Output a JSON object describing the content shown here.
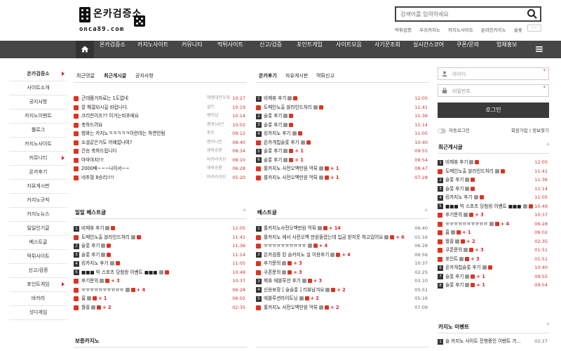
{
  "logo": {
    "title": "온카검증소",
    "site": "onca89.com"
  },
  "search": {
    "placeholder": "검색어를 입력하세요"
  },
  "keywords": [
    "먹튀검증",
    "우리카지노",
    "카지노사이트",
    "온라인카지노",
    "슬롯"
  ],
  "keyword_arrows": "‹ ›",
  "nav": [
    "온카검증소",
    "카지노사이트",
    "커뮤니티",
    "먹튀사이트",
    "신고/검증",
    "포인트게임",
    "사이트모음",
    "사기꾼조회",
    "실시간스코어",
    "쿠폰/문의",
    "업체홍보"
  ],
  "left_menu": [
    {
      "label": "온카검증소",
      "arrow": true
    },
    {
      "label": "사이트소개"
    },
    {
      "label": "공지사항"
    },
    {
      "label": "카지노이벤트"
    },
    {
      "label": "쁠로그"
    },
    {
      "label": "카지노사이트"
    },
    {
      "label": "커뮤니티",
      "arrow": true
    },
    {
      "label": "온카후기"
    },
    {
      "label": "자유게시판"
    },
    {
      "label": "카지노규칙"
    },
    {
      "label": "카지노뉴스"
    },
    {
      "label": "일일인기글"
    },
    {
      "label": "베스트글"
    },
    {
      "label": "먹튀사이트"
    },
    {
      "label": "신고/검증"
    },
    {
      "label": "포인트게임",
      "arrow": true
    },
    {
      "label": "바카라"
    },
    {
      "label": "섯다게임"
    }
  ],
  "panel1": {
    "tabs": [
      "최근댓글",
      "최근게시글",
      "공지사항"
    ],
    "rows": [
      {
        "t": "근데줌거자료는 1도없네",
        "a": "해병대전우회",
        "d": "10:27"
      },
      {
        "t": "잘 해결되시길 바랍니다.",
        "a": "골트",
        "d": "10:19"
      },
      {
        "t": "크리천이즈?? 이거는비추에요",
        "a": "뱅커샀",
        "d": "10:14"
      },
      {
        "t": "축하드려요",
        "a": "평큐19년",
        "d": "10:02"
      },
      {
        "t": "첨봐는 카지노ㅋㅋㅋㅋㅋ이런데는 하면안됨",
        "a": "돗뜨",
        "d": "09:12"
      },
      {
        "t": "소셜같은거도 어예없나여?",
        "a": "뱅커나인",
        "d": "08:40"
      },
      {
        "t": "건승 축하드립니다",
        "a": "생바승환",
        "d": "08:34"
      },
      {
        "t": "아마야지!!!",
        "a": "바카라귀신",
        "d": "08:10"
      },
      {
        "t": "2000배~~~나이서~~",
        "a": "생바승환",
        "d": "06:28"
      },
      {
        "t": "네추혈 8승리!!!!",
        "a": "바카라귀신",
        "d": "05:20"
      }
    ]
  },
  "panel2": {
    "tabs": [
      "온카후기",
      "자유게시판",
      "먹튀신고"
    ],
    "rows": [
      {
        "n": "1",
        "t": "비제휴 후기",
        "d": "12:05"
      },
      {
        "t": "도메인노출 블라인드처리",
        "d": "11:41"
      },
      {
        "n": "2",
        "t": "슬롯 후기",
        "d": "11:36"
      },
      {
        "n": "3",
        "t": "슬롯 후기",
        "d": "11:14"
      },
      {
        "n": "4",
        "t": "킹카지노 후기",
        "d": "11:05"
      },
      {
        "t": "온카개칩슬롯 후기",
        "d": "10:40"
      },
      {
        "n": "5",
        "t": "슬롯 후기",
        "p": "+ 1",
        "d": "09:55"
      },
      {
        "n": "6",
        "t": "슬롯 후기",
        "p": "+ 1",
        "d": "09:54"
      },
      {
        "t": "룰카지노 사전오백만원 먹튀",
        "p": "+ 1",
        "d": "08:47"
      },
      {
        "t": "룰카지노 사전오백만원 먹튀",
        "p": "+ 1",
        "d": "07:28"
      }
    ]
  },
  "daily_best": {
    "title": "일일 베스트글",
    "rows": [
      {
        "n": "1",
        "t": "비제휴 후기",
        "d": "12:05"
      },
      {
        "t": "도메인노출 블라인드처리",
        "d": "11:41"
      },
      {
        "n": "2",
        "t": "슬롯 후기",
        "d": "11:36"
      },
      {
        "n": "3",
        "t": "슬롯 후기",
        "d": "11:14"
      },
      {
        "n": "4",
        "t": "킹카지노 후기",
        "d": "11:05"
      },
      {
        "n": "5",
        "t": "■■■ 빅 스포츠 당첨왕 이벤트 ■■■",
        "d": "10:49"
      },
      {
        "t": "후기문의",
        "p": "+ 3",
        "d": "10:37"
      },
      {
        "t": "ㅠㅠㅠㅠㅠㅠㅠㅠㅠㅠ",
        "p": "+ 4",
        "d": "06:28"
      },
      {
        "t": "홈",
        "p": "+ 1",
        "d": "06:02"
      },
      {
        "t": "월플",
        "p": "+ 2",
        "d": "02:35"
      }
    ]
  },
  "best": {
    "title": "베스트글",
    "rows": [
      {
        "n": "1",
        "t": "룰카지노사전오백만원 먹튀",
        "p": "+ 14",
        "d": "06:40"
      },
      {
        "t": "룰카지노 에서 사전오백 만원돌렸는데 입금 받지못 하고있어요",
        "p": "+ 6",
        "d": "01:16"
      },
      {
        "t": "ㅠㅠㅠㅠㅠㅠㅠㅠㅠㅠ",
        "p": "+ 4",
        "d": "06:28"
      },
      {
        "n": "2",
        "t": "온카검증 된 슬카지노 실 이용후기",
        "p": "+ 4",
        "d": "06:56"
      },
      {
        "t": "후기문의",
        "p": "+ 3",
        "d": "10:37"
      },
      {
        "t": "쿠폰문의",
        "p": "+ 3",
        "d": "02:25"
      },
      {
        "n": "3",
        "t": "제휴 에볼루션 후기",
        "p": "+ 3",
        "d": "03.10"
      },
      {
        "n": "4",
        "t": "신용보장 [ 슬슬롯 ] 리뷰남겨요",
        "p": "+ 2",
        "d": "05:51"
      },
      {
        "n": "5",
        "t": "에볼루션라이트닝",
        "p": "+ 2",
        "d": "05:16"
      },
      {
        "t": "룰카지노 사전오백만원 먹튀",
        "p": "+ 2",
        "d": "07:09"
      }
    ]
  },
  "casino_news": {
    "title": "보증카지노"
  },
  "login": {
    "id_placeholder": "아이디",
    "pw_placeholder": "비밀번호",
    "star": "*",
    "button": "로그인",
    "auto": "자동로그인",
    "join": "회원가입 | 정보찾기"
  },
  "recent": {
    "title": "최근게시글",
    "rows": [
      {
        "n": "1",
        "t": "비제휴 후기",
        "d": "12:05"
      },
      {
        "t": "도메인노출 블라인드처리",
        "d": "11:41"
      },
      {
        "n": "2",
        "t": "슬롯 후기",
        "d": "11:36"
      },
      {
        "n": "3",
        "t": "슬롯 후기",
        "d": "11:14"
      },
      {
        "n": "4",
        "t": "킹카지노 후기",
        "d": "11:05"
      },
      {
        "n": "5",
        "t": "■■■ 빅 스포츠 당첨왕 이벤트 ■■■",
        "d": "10:49"
      },
      {
        "t": "후기문의",
        "p": "+ 3",
        "d": "10:37"
      },
      {
        "t": "ㅠㅠㅠㅠㅠㅠㅠㅠㅠㅠ",
        "p": "+ 4",
        "d": "06:28"
      },
      {
        "t": "홈",
        "p": "+ 1",
        "d": "06:02"
      },
      {
        "t": "월플",
        "p": "+ 2",
        "d": "02:35"
      },
      {
        "t": "쿠폰문의",
        "p": "+ 3",
        "d": "01:51"
      },
      {
        "t": "포인트",
        "p": "+ 3",
        "d": "01:51"
      },
      {
        "n": "6",
        "t": "온카개칩슬롯 후기",
        "d": "10:40"
      },
      {
        "n": "7",
        "t": "슬롯 후기",
        "p": "+ 1",
        "d": "09:55"
      },
      {
        "n": "8",
        "t": "슬롯 후기",
        "p": "+ 1",
        "d": "09:54"
      }
    ]
  },
  "event": {
    "title": "카지노 이벤트",
    "rows": [
      {
        "n": "1",
        "t": "슬 카지노 사이트 진행중인 이벤트 가...",
        "d": "02:27"
      }
    ]
  }
}
